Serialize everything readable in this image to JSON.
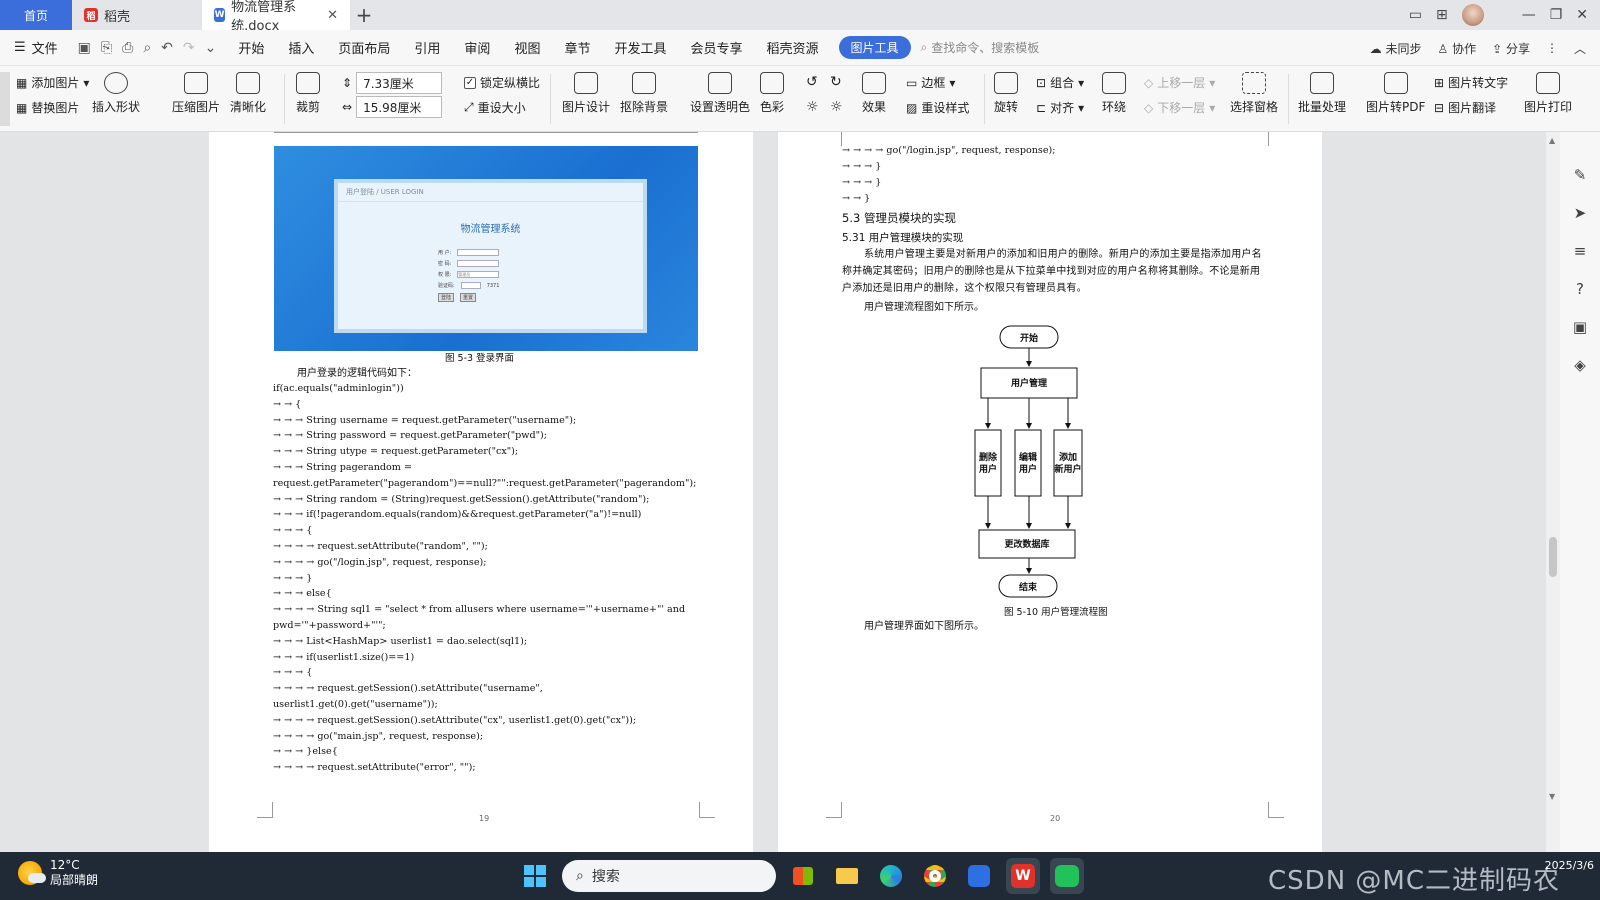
{
  "tabs": {
    "home": "首页",
    "daoke": "稻壳",
    "doc": "物流管理系统.docx"
  },
  "menu": {
    "file": "文件",
    "items": [
      "开始",
      "插入",
      "页面布局",
      "引用",
      "审阅",
      "视图",
      "章节",
      "开发工具",
      "会员专享",
      "稻壳资源"
    ],
    "active": "图片工具",
    "search": "查找命令、搜索模板",
    "sync": "未同步",
    "collab": "协作",
    "share": "分享"
  },
  "ribbon": {
    "add_image": "添加图片",
    "replace_image": "替换图片",
    "insert_shape": "插入形状",
    "compress": "压缩图片",
    "sharpen": "清晰化",
    "crop": "裁剪",
    "width": "7.33厘米",
    "height": "15.98厘米",
    "lock_ratio": "锁定纵横比",
    "reset_size": "重设大小",
    "design": "图片设计",
    "remove_bg": "抠除背景",
    "transparent": "设置透明色",
    "color": "色彩",
    "effect": "效果",
    "border": "边框",
    "reset_style": "重设样式",
    "rotate": "旋转",
    "group": "组合",
    "align": "对齐",
    "wrap": "环绕",
    "bring_forward": "上移一层",
    "send_backward": "下移一层",
    "selection_pane": "选择窗格",
    "batch": "批量处理",
    "to_pdf": "图片转PDF",
    "to_text": "图片转文字",
    "translate": "图片翻译",
    "print": "图片打印"
  },
  "left_page": {
    "login": {
      "header": "用户登陆 / USER LOGIN",
      "system": "物流管理系统",
      "user_label": "用 户:",
      "pwd_label": "密 码:",
      "perm_label": "权 限:",
      "perm_value": "管理员",
      "code_label": "验证码:",
      "code_value": "7371",
      "login_btn": "登陆",
      "reset_btn": "重置"
    },
    "caption": "图 5-3 登录界面",
    "intro": "用户登录的逻辑代码如下：",
    "code": [
      "if(ac.equals(\"adminlogin\"))",
      "→   →   {",
      "→   →   →   String username = request.getParameter(\"username\");",
      "→   →   →   String password = request.getParameter(\"pwd\");",
      "→   →   →   String utype = request.getParameter(\"cx\");",
      "→   →   →   String pagerandom =",
      "request.getParameter(\"pagerandom\")==null?\"\":request.getParameter(\"pagerandom\");",
      "→   →   →   String random = (String)request.getSession().getAttribute(\"random\");",
      "→   →   →   if(!pagerandom.equals(random)&&request.getParameter(\"a\")!=null)",
      "→   →   →   {",
      "→   →   →   →   request.setAttribute(\"random\", \"\");",
      "→   →   →   →   go(\"/login.jsp\", request, response);",
      "→   →   →   }",
      "→   →   →   else{",
      "→   →   →   →   String sql1 = \"select * from allusers where username='\"+username+\"' and",
      "pwd='\"+password+\"'\";",
      "→   →   →   List<HashMap> userlist1 = dao.select(sql1);",
      "→   →   →   if(userlist1.size()==1)",
      "→   →   →   {",
      "→   →   →   →   request.getSession().setAttribute(\"username\",",
      "userlist1.get(0).get(\"username\"));",
      "→   →   →   →   request.getSession().setAttribute(\"cx\", userlist1.get(0).get(\"cx\"));",
      "→   →   →   →   go(\"main.jsp\", request, response);",
      "→   →   →   }else{",
      "→   →   →   →   request.setAttribute(\"error\", \"\");"
    ],
    "page_num": "19"
  },
  "right_page": {
    "code": [
      "→   →   →   →   go(\"/login.jsp\", request, response);",
      "→   →   →   }",
      "→   →   →   }",
      "→   →   }"
    ],
    "h53": "5.3 管理员模块的实现",
    "h531": "5.31 用户管理模块的实现",
    "para1": "系统用户管理主要是对新用户的添加和旧用户的删除。新用户的添加主要是指添加用户名称并确定其密码；旧用户的删除也是从下拉菜单中找到对应的用户名称将其删除。不论是新用户添加还是旧用户的删除，这个权限只有管理员具有。",
    "para2": "用户管理流程图如下所示。",
    "flow": {
      "start": "开始",
      "manage": "用户管理",
      "delete1": "删除",
      "delete2": "用户",
      "edit1": "编辑",
      "edit2": "用户",
      "add1": "添加",
      "add2": "新用户",
      "update": "更改数据库",
      "end": "结束"
    },
    "caption": "图 5-10 用户管理流程图",
    "para3": "用户管理界面如下图所示。",
    "page_num": "20"
  },
  "taskbar": {
    "temp": "12°C",
    "weather": "局部晴朗",
    "search": "搜索",
    "watermark": "CSDN @MC二进制码农",
    "date": "2025/3/6"
  },
  "colors": {
    "accent": "#3b6ddb",
    "taskbar": "#1f2a36",
    "wps_red": "#e0322b"
  }
}
